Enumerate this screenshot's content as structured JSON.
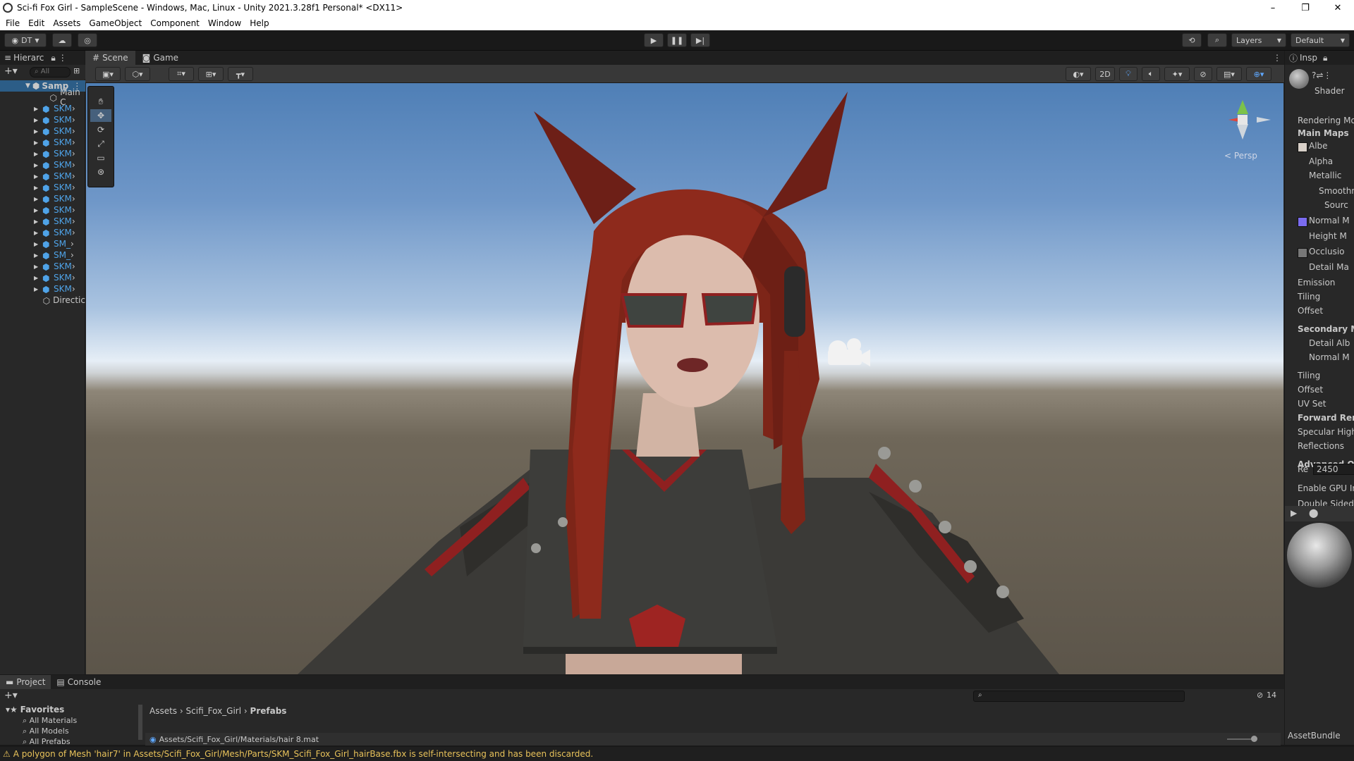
{
  "window": {
    "title": "Sci-fi Fox Girl - SampleScene - Windows, Mac, Linux - Unity 2021.3.28f1 Personal* <DX11>",
    "controls": [
      "minimize-icon",
      "restore-icon",
      "close-icon"
    ]
  },
  "menu": [
    "File",
    "Edit",
    "Assets",
    "GameObject",
    "Component",
    "Window",
    "Help"
  ],
  "toolbar": {
    "account": "DT",
    "layers": "Layers",
    "layout": "Default"
  },
  "hierarchy": {
    "tab": "Hierarc",
    "search_placeholder": "All",
    "root": "Samp",
    "items": [
      "Main C",
      "SKM",
      "SKM",
      "SKM",
      "SKM",
      "SKM",
      "SKM",
      "SKM",
      "SKM",
      "SKM",
      "SKM",
      "SKM",
      "SKM",
      "SM_",
      "SM_",
      "SKM",
      "SKM",
      "SKM",
      "Directic"
    ]
  },
  "scene": {
    "tabs": [
      "Scene",
      "Game"
    ],
    "toggle_2d": "2D",
    "persp": "< Persp"
  },
  "inspector": {
    "tab": "Insp",
    "shader": "Shader",
    "rows": [
      {
        "label": "Rendering Mo",
        "bold": false
      },
      {
        "label": "Main Maps",
        "bold": true
      },
      {
        "label": "Albe",
        "bold": false
      },
      {
        "label": "Alpha",
        "bold": false
      },
      {
        "label": "Metallic",
        "bold": false
      },
      {
        "label": "Smoothn",
        "bold": false
      },
      {
        "label": "Sourc",
        "bold": false
      },
      {
        "label": "Normal M",
        "bold": false
      },
      {
        "label": "Height M",
        "bold": false
      },
      {
        "label": "Occlusio",
        "bold": false
      },
      {
        "label": "Detail Ma",
        "bold": false
      },
      {
        "label": "Emission",
        "bold": false
      },
      {
        "label": "Tiling",
        "bold": false
      },
      {
        "label": "Offset",
        "bold": false
      },
      {
        "label": "Secondary M",
        "bold": true
      },
      {
        "label": "Detail Alb",
        "bold": false
      },
      {
        "label": "Normal M",
        "bold": false
      },
      {
        "label": "Tiling",
        "bold": false
      },
      {
        "label": "Offset",
        "bold": false
      },
      {
        "label": "UV Set",
        "bold": false
      },
      {
        "label": "Forward Ren",
        "bold": true
      },
      {
        "label": "Specular High",
        "bold": false
      },
      {
        "label": "Reflections",
        "bold": false
      },
      {
        "label": "Advanced O|",
        "bold": true
      },
      {
        "label": "Enable GPU In",
        "bold": false
      },
      {
        "label": "Double Sided",
        "bold": false
      }
    ],
    "render_queue_label": "Re",
    "render_queue_value": "2450",
    "asset_bundle": "AssetBundle"
  },
  "project": {
    "tabs": [
      "Project",
      "Console"
    ],
    "favorites": "Favorites",
    "fav_items": [
      "All Materials",
      "All Models",
      "All Prefabs"
    ],
    "breadcrumb": [
      "Assets",
      "Scifi_Fox_Girl",
      "Prefabs"
    ],
    "selected_path": "Assets/Scifi_Fox_Girl/Materials/hair 8.mat",
    "hidden_count": "14"
  },
  "status": {
    "message": "A polygon of Mesh 'hair7' in Assets/Scifi_Fox_Girl/Mesh/Parts/SKM_Scifi_Fox_Girl_hairBase.fbx is self-intersecting and has been discarded."
  },
  "colors": {
    "normal_swatch": "#7b6cf0",
    "sky_top": "#4f7fb6",
    "ground": "#6f6759",
    "hair": "#8e2a1c"
  }
}
